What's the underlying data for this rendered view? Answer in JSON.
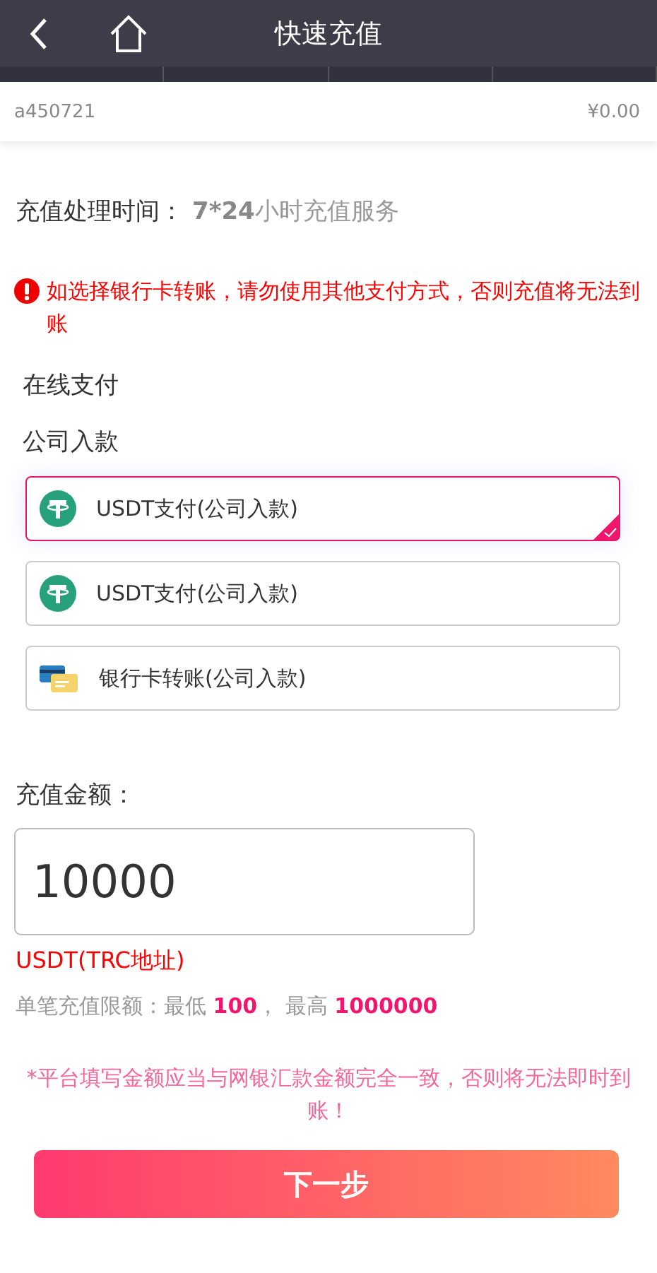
{
  "header": {
    "title": "快速充值"
  },
  "account": {
    "username": "a450721",
    "balance": "¥0.00"
  },
  "processing": {
    "label": "充值处理时间：",
    "hours": "7*24",
    "service": "小时充值服务"
  },
  "warning": "如选择银行卡转账，请勿使用其他支付方式，否则充值将无法到账",
  "sections": [
    "在线支付",
    "公司入款"
  ],
  "methods": [
    {
      "kind": "usdt",
      "label": "USDT支付(公司入款)",
      "selected": true
    },
    {
      "kind": "usdt",
      "label": "USDT支付(公司入款)",
      "selected": false
    },
    {
      "kind": "bank",
      "label": "银行卡转账(公司入款)",
      "selected": false
    }
  ],
  "amount": {
    "label": "充值金额：",
    "value": "10000",
    "network": "USDT(TRC地址)",
    "limits": "单笔充值限额：最低 **100**， 最高 **1000000**"
  },
  "notice": "*平台填写金额应当与网银汇款金额完全一致，否则将无法即时到账！",
  "next_button": "下一步"
}
